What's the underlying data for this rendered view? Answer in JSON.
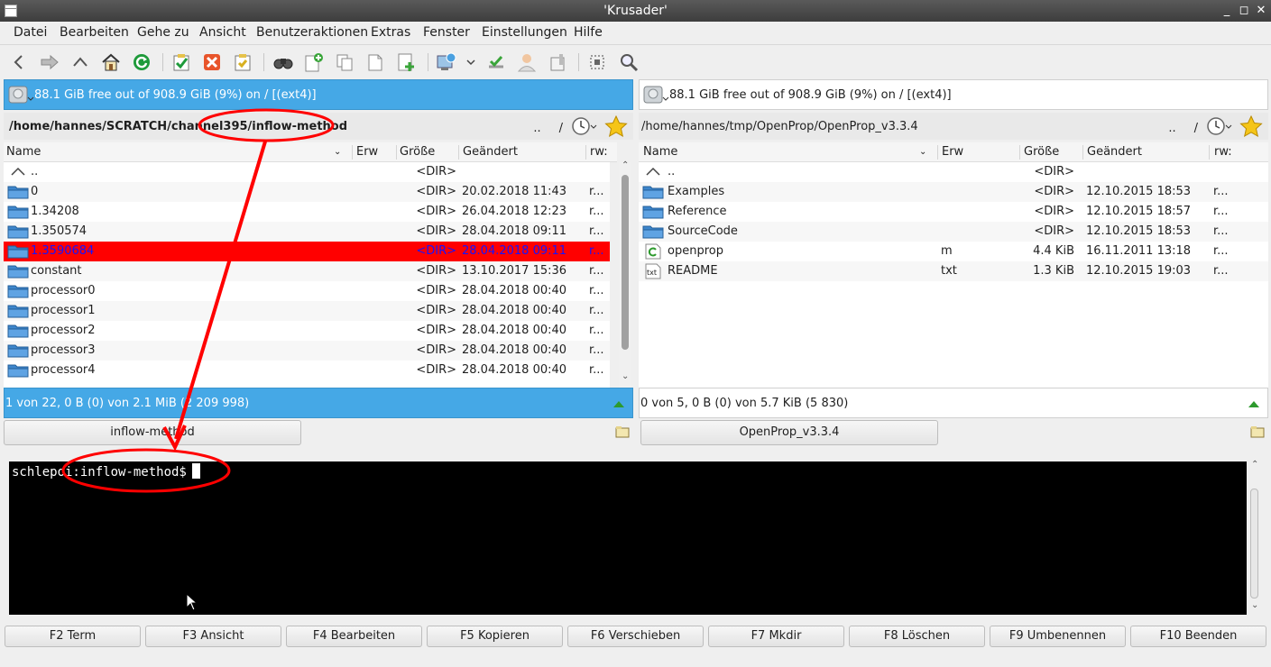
{
  "window": {
    "title": "'Krusader'"
  },
  "menu": [
    "Datei",
    "Bearbeiten",
    "Gehe zu",
    "Ansicht",
    "Benutzeraktionen",
    "Extras",
    "Fenster",
    "Einstellungen",
    "Hilfe"
  ],
  "toolbar_icons": [
    "back-icon",
    "forward-icon",
    "up-icon",
    "home-icon",
    "reload-icon",
    "select-all-icon",
    "unselect-icon",
    "invert-selection-icon",
    "search-icon",
    "new-icon",
    "copy-icon",
    "paste-icon",
    "add-icon",
    "network-icon",
    "sync-icon",
    "user-icon",
    "archive-icon",
    "popup-panel-icon",
    "zoom-icon"
  ],
  "left_panel": {
    "free_space": "88.1 GiB free out of 908.9 GiB (9%) on / [(ext4)]",
    "path": "/home/hannes/SCRATCH/channel395/inflow-method",
    "path_up": "..",
    "path_root": "/",
    "columns": [
      "Name",
      "Erw",
      "Größe",
      "Geändert",
      "rw:"
    ],
    "rows": [
      {
        "name": "..",
        "ext": "",
        "size": "<DIR>",
        "date": "",
        "perm": ""
      },
      {
        "name": "0",
        "ext": "",
        "size": "<DIR>",
        "date": "20.02.2018 11:43",
        "perm": "r..."
      },
      {
        "name": "1.34208",
        "ext": "",
        "size": "<DIR>",
        "date": "26.04.2018 12:23",
        "perm": "r..."
      },
      {
        "name": "1.350574",
        "ext": "",
        "size": "<DIR>",
        "date": "28.04.2018 09:11",
        "perm": "r..."
      },
      {
        "name": "1.3590684",
        "ext": "",
        "size": "<DIR>",
        "date": "28.04.2018 09:11",
        "perm": "r...",
        "selected": true
      },
      {
        "name": "constant",
        "ext": "",
        "size": "<DIR>",
        "date": "13.10.2017 15:36",
        "perm": "r..."
      },
      {
        "name": "processor0",
        "ext": "",
        "size": "<DIR>",
        "date": "28.04.2018 00:40",
        "perm": "r..."
      },
      {
        "name": "processor1",
        "ext": "",
        "size": "<DIR>",
        "date": "28.04.2018 00:40",
        "perm": "r..."
      },
      {
        "name": "processor2",
        "ext": "",
        "size": "<DIR>",
        "date": "28.04.2018 00:40",
        "perm": "r..."
      },
      {
        "name": "processor3",
        "ext": "",
        "size": "<DIR>",
        "date": "28.04.2018 00:40",
        "perm": "r..."
      },
      {
        "name": "processor4",
        "ext": "",
        "size": "<DIR>",
        "date": "28.04.2018 00:40",
        "perm": "r..."
      }
    ],
    "status": "1 von 22, 0 B (0) von 2.1 MiB (2 209 998)",
    "tab": "inflow-method"
  },
  "right_panel": {
    "free_space": "88.1 GiB free out of 908.9 GiB (9%) on / [(ext4)]",
    "path": "/home/hannes/tmp/OpenProp/OpenProp_v3.3.4",
    "path_up": "..",
    "path_root": "/",
    "columns": [
      "Name",
      "Erw",
      "Größe",
      "Geändert",
      "rw:"
    ],
    "rows": [
      {
        "name": "..",
        "ext": "",
        "size": "<DIR>",
        "date": "",
        "perm": "",
        "icon": "up"
      },
      {
        "name": "Examples",
        "ext": "",
        "size": "<DIR>",
        "date": "12.10.2015 18:53",
        "perm": "r...",
        "icon": "folder"
      },
      {
        "name": "Reference",
        "ext": "",
        "size": "<DIR>",
        "date": "12.10.2015 18:57",
        "perm": "r...",
        "icon": "folder"
      },
      {
        "name": "SourceCode",
        "ext": "",
        "size": "<DIR>",
        "date": "12.10.2015 18:53",
        "perm": "r...",
        "icon": "folder"
      },
      {
        "name": "openprop",
        "ext": "m",
        "size": "4.4 KiB",
        "date": "16.11.2011 13:18",
        "perm": "r...",
        "icon": "script"
      },
      {
        "name": "README",
        "ext": "txt",
        "size": "1.3 KiB",
        "date": "12.10.2015 19:03",
        "perm": "r...",
        "icon": "txt"
      }
    ],
    "status": "0 von 5, 0 B (0) von 5.7 KiB (5 830)",
    "tab": "OpenProp_v3.3.4"
  },
  "terminal": {
    "prompt": "schlepoi:inflow-method$"
  },
  "fkeys": [
    "F2 Term",
    "F3 Ansicht",
    "F4 Bearbeiten",
    "F5 Kopieren",
    "F6 Verschieben",
    "F7 Mkdir",
    "F8 Löschen",
    "F9 Umbenennen",
    "F10 Beenden"
  ],
  "colors": {
    "active_bar": "#45a8e6",
    "selection": "#ff0000",
    "selection_text": "#1414ff",
    "annotation": "#ff0000"
  }
}
